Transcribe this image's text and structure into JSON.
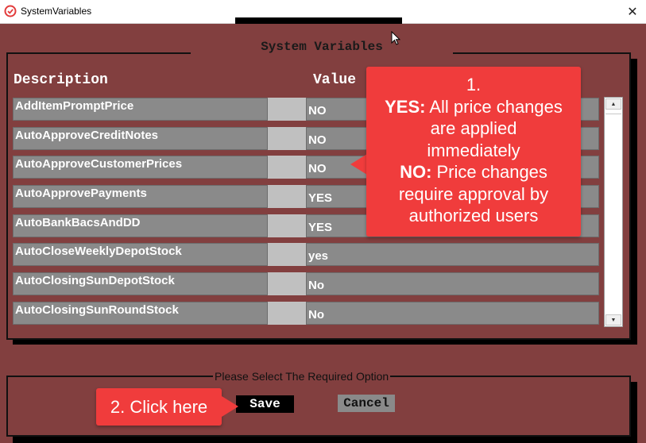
{
  "window": {
    "title": "SystemVariables",
    "close_glyph": "✕"
  },
  "form": {
    "heading": "System Variables",
    "col_description": "Description",
    "col_value": "Value",
    "rows": [
      {
        "description": "AddItemPromptPrice",
        "value": "NO"
      },
      {
        "description": "AutoApproveCreditNotes",
        "value": "NO"
      },
      {
        "description": "AutoApproveCustomerPrices",
        "value": "NO"
      },
      {
        "description": "AutoApprovePayments",
        "value": "YES"
      },
      {
        "description": "AutoBankBacsAndDD",
        "value": "YES"
      },
      {
        "description": "AutoCloseWeeklyDepotStock",
        "value": "yes"
      },
      {
        "description": "AutoClosingSunDepotStock",
        "value": "No"
      },
      {
        "description": "AutoClosingSunRoundStock",
        "value": "No"
      }
    ]
  },
  "scrollbar": {
    "up_glyph": "▲",
    "down_glyph": "▼"
  },
  "options": {
    "prompt": "Please Select The Required Option",
    "save_label": "Save",
    "cancel_label": "Cancel"
  },
  "callouts": {
    "first": {
      "number": "1.",
      "yes_label": "YES:",
      "yes_text_1": " All price changes",
      "yes_text_2": "are applied",
      "yes_text_3": "immediately",
      "no_label": "NO:",
      "no_text_1": " Price changes",
      "no_text_2": "require approval by",
      "no_text_3": "authorized users"
    },
    "second": {
      "text": "2. Click here"
    }
  },
  "colors": {
    "background": "#823f3f",
    "field": "#8a8a8a",
    "callout": "#f03c3c"
  },
  "icons": {
    "app": "app-logo-icon",
    "close": "close-icon",
    "cursor": "mouse-cursor-icon"
  }
}
